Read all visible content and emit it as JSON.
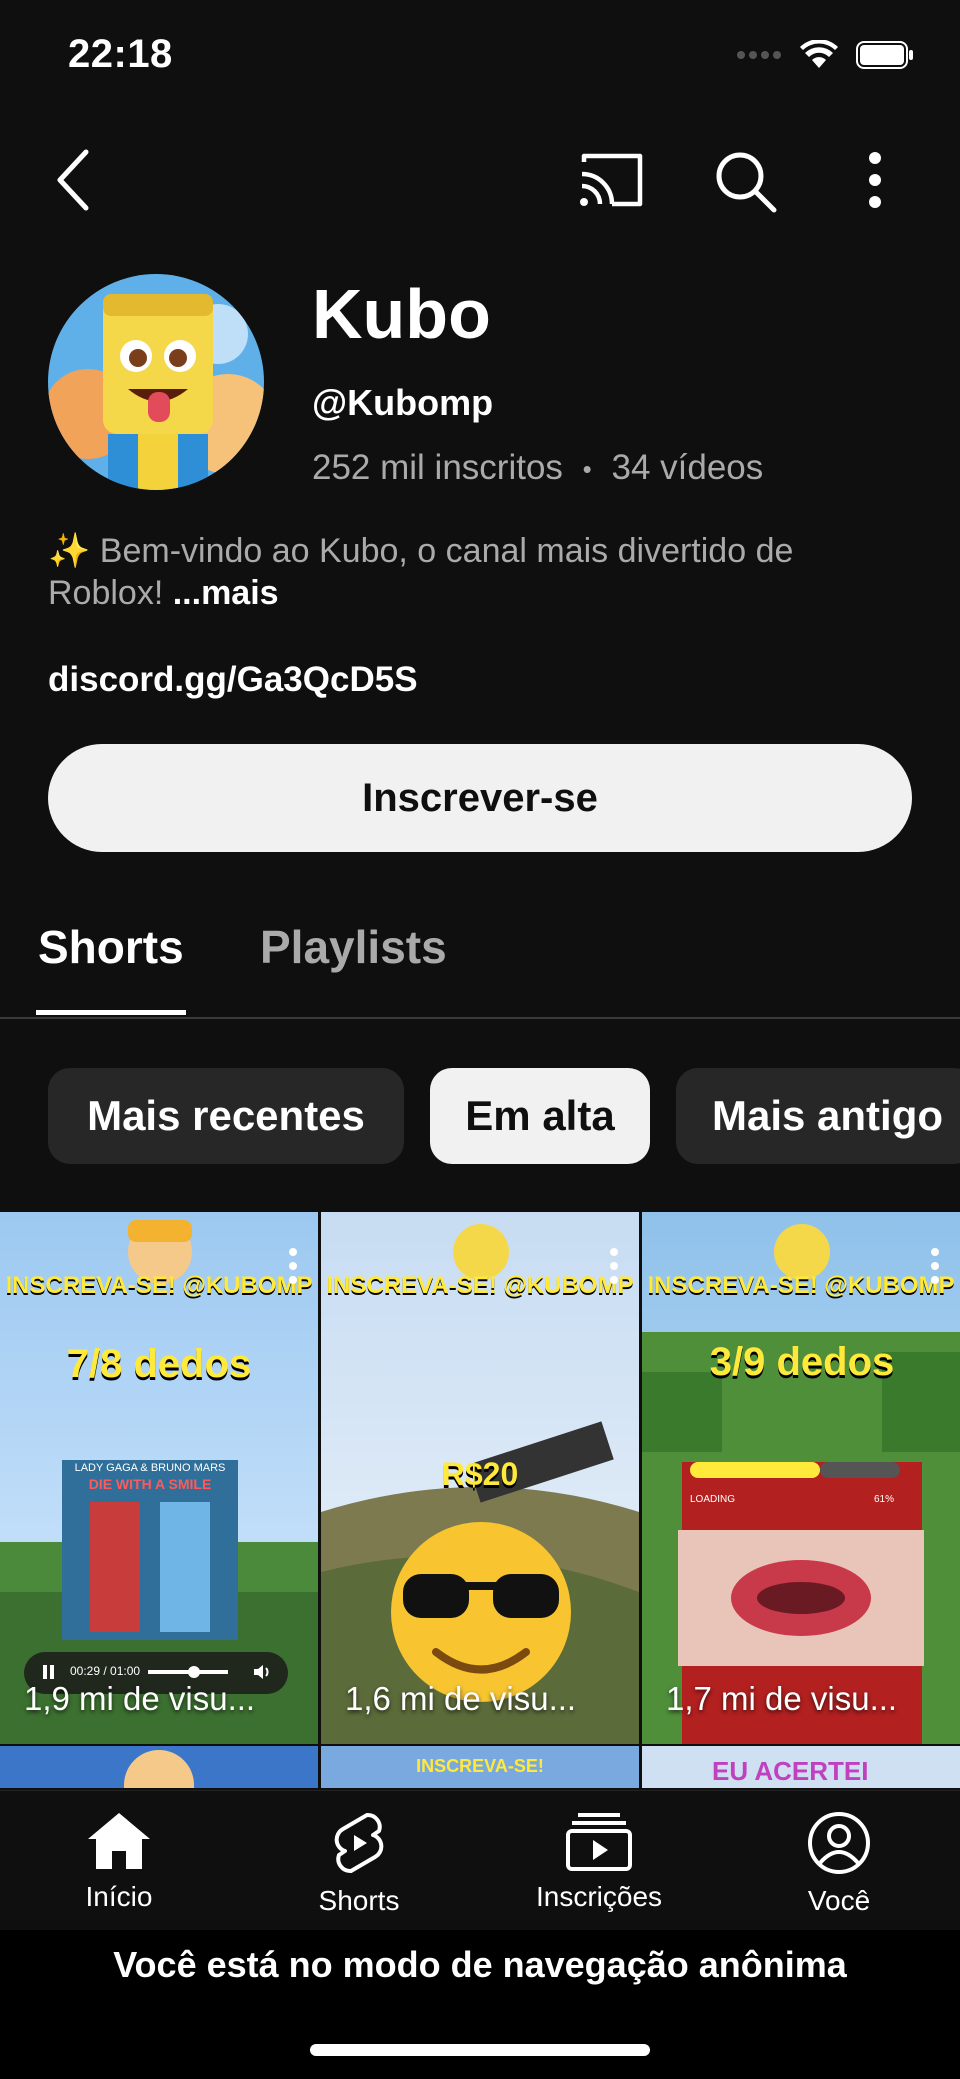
{
  "status_bar": {
    "time": "22:18"
  },
  "top_nav": {
    "back_icon": "chevron-left-icon",
    "cast_icon": "cast-icon",
    "search_icon": "search-icon",
    "more_icon": "more-vertical-icon"
  },
  "channel": {
    "name": "Kubo",
    "handle": "@Kubomp",
    "subscribers": "252 mil inscritos",
    "separator": "•",
    "videos": "34 vídeos",
    "description": "✨ Bem-vindo ao Kubo, o canal mais divertido de Roblox!",
    "description_more": "...mais",
    "link": "discord.gg/Ga3QcD5S",
    "subscribe_label": "Inscrever-se"
  },
  "tabs": [
    {
      "label": "Shorts",
      "active": true
    },
    {
      "label": "Playlists",
      "active": false
    }
  ],
  "filters": [
    {
      "label": "Mais recentes",
      "active": false
    },
    {
      "label": "Em alta",
      "active": true
    },
    {
      "label": "Mais antigo",
      "active": false
    }
  ],
  "shorts": [
    {
      "views": "1,9 mi de visu...",
      "overlay_top": "INSCREVA-SE! @KUBOMP",
      "overlay_mid": "7/8 dedos",
      "overlay_sub": "LADY GAGA & BRUNO MARS",
      "overlay_sub2": "DIE WITH A SMILE",
      "player_time": "00:29 / 01:00"
    },
    {
      "views": "1,6 mi de visu...",
      "overlay_top": "INSCREVA-SE! @KUBOMP",
      "overlay_mid": "R$20"
    },
    {
      "views": "1,7 mi de visu...",
      "overlay_top": "INSCREVA-SE! @KUBOMP",
      "overlay_mid": "3/9 dedos",
      "loading_label": "LOADING",
      "loading_pct": "61%"
    }
  ],
  "shorts_row2": [
    {
      "overlay_top": ""
    },
    {
      "overlay_top": "INSCREVA-SE!"
    },
    {
      "overlay_top": "EU ACERTEI"
    }
  ],
  "bottom_nav": [
    {
      "label": "Início",
      "icon": "home-icon"
    },
    {
      "label": "Shorts",
      "icon": "shorts-icon"
    },
    {
      "label": "Inscrições",
      "icon": "subscriptions-icon"
    },
    {
      "label": "Você",
      "icon": "account-icon"
    }
  ],
  "incognito_notice": "Você está no modo de navegação anônima",
  "colors": {
    "background": "#0f0f0f",
    "chip": "#272727",
    "chip_active": "#f1f1f1",
    "secondary_text": "#aaaaaa",
    "accent_yellow": "#ffe93b"
  }
}
